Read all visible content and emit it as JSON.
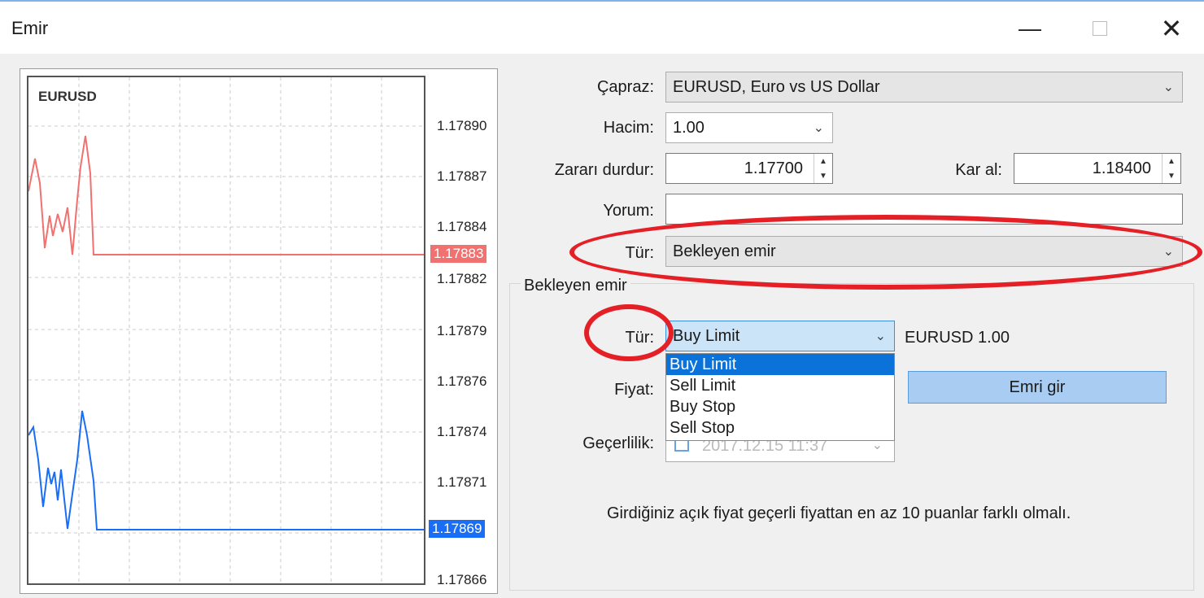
{
  "window": {
    "title": "Emir",
    "minimize": "—",
    "maximize": "",
    "close": "✕"
  },
  "chart": {
    "symbol": "EURUSD",
    "y_ticks": [
      "1.17890",
      "1.17887",
      "1.17884",
      "1.17882",
      "1.17879",
      "1.17876",
      "1.17874",
      "1.17871",
      "1.17866"
    ],
    "ask_tag": "1.17883",
    "bid_tag": "1.17869",
    "ask_color": "#f0716f",
    "bid_color": "#1a6ef5"
  },
  "form": {
    "cross_label": "Çapraz:",
    "cross_value": "EURUSD, Euro vs US Dollar",
    "volume_label": "Hacim:",
    "volume_value": "1.00",
    "stoploss_label": "Zararı durdur:",
    "stoploss_value": "1.17700",
    "takeprofit_label": "Kar al:",
    "takeprofit_value": "1.18400",
    "comment_label": "Yorum:",
    "comment_value": "",
    "type_label": "Tür:",
    "type_value": "Bekleyen emir"
  },
  "pending": {
    "group_title": "Bekleyen emir",
    "type_label": "Tür:",
    "type_value": "Buy Limit",
    "options": [
      "Buy Limit",
      "Sell Limit",
      "Buy Stop",
      "Sell Stop"
    ],
    "side_info": "EURUSD 1.00",
    "price_label": "Fiyat:",
    "submit_label": "Emri gir",
    "validity_label": "Geçerlilik:",
    "validity_value": "2017.12.15 11:37",
    "info": "Girdiğiniz açık fiyat geçerli fiyattan en az 10 puanlar farklı olmalı."
  },
  "annotation_color": "#e41f26"
}
